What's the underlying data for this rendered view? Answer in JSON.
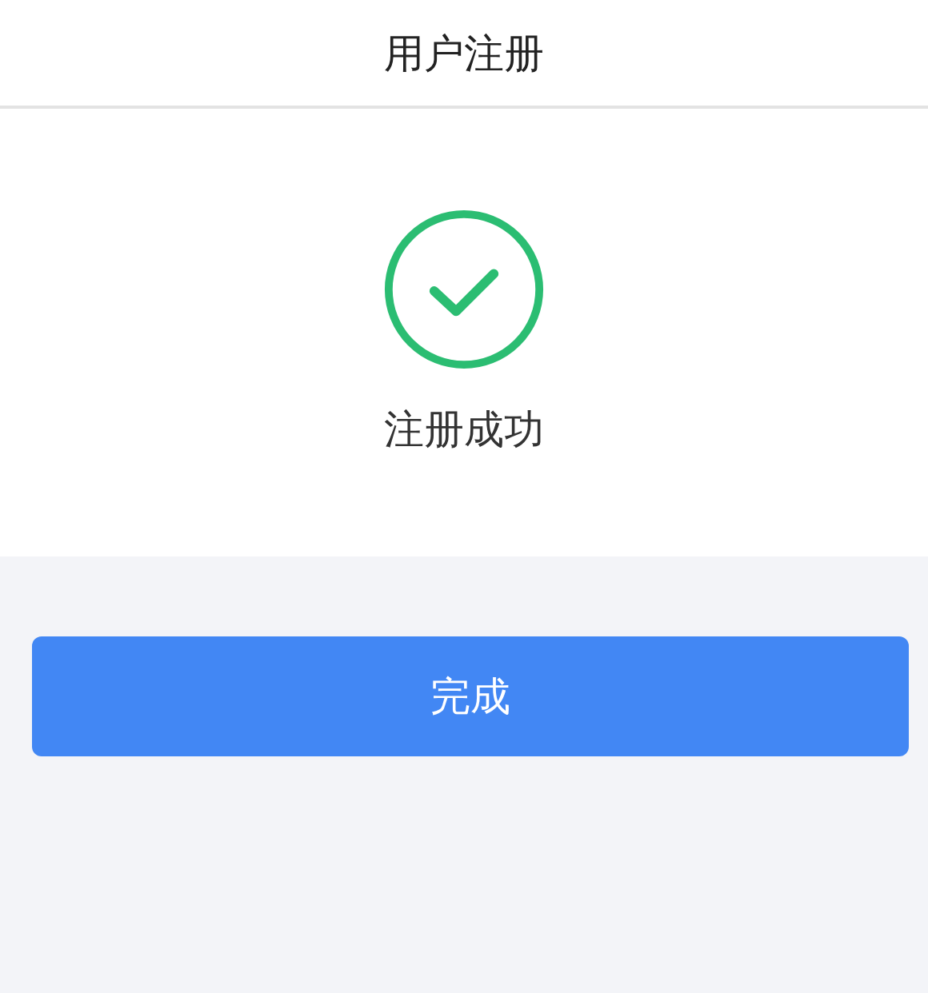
{
  "header": {
    "title": "用户注册"
  },
  "result": {
    "succeeded": true,
    "message": "注册成功"
  },
  "button": {
    "label": "完成"
  }
}
